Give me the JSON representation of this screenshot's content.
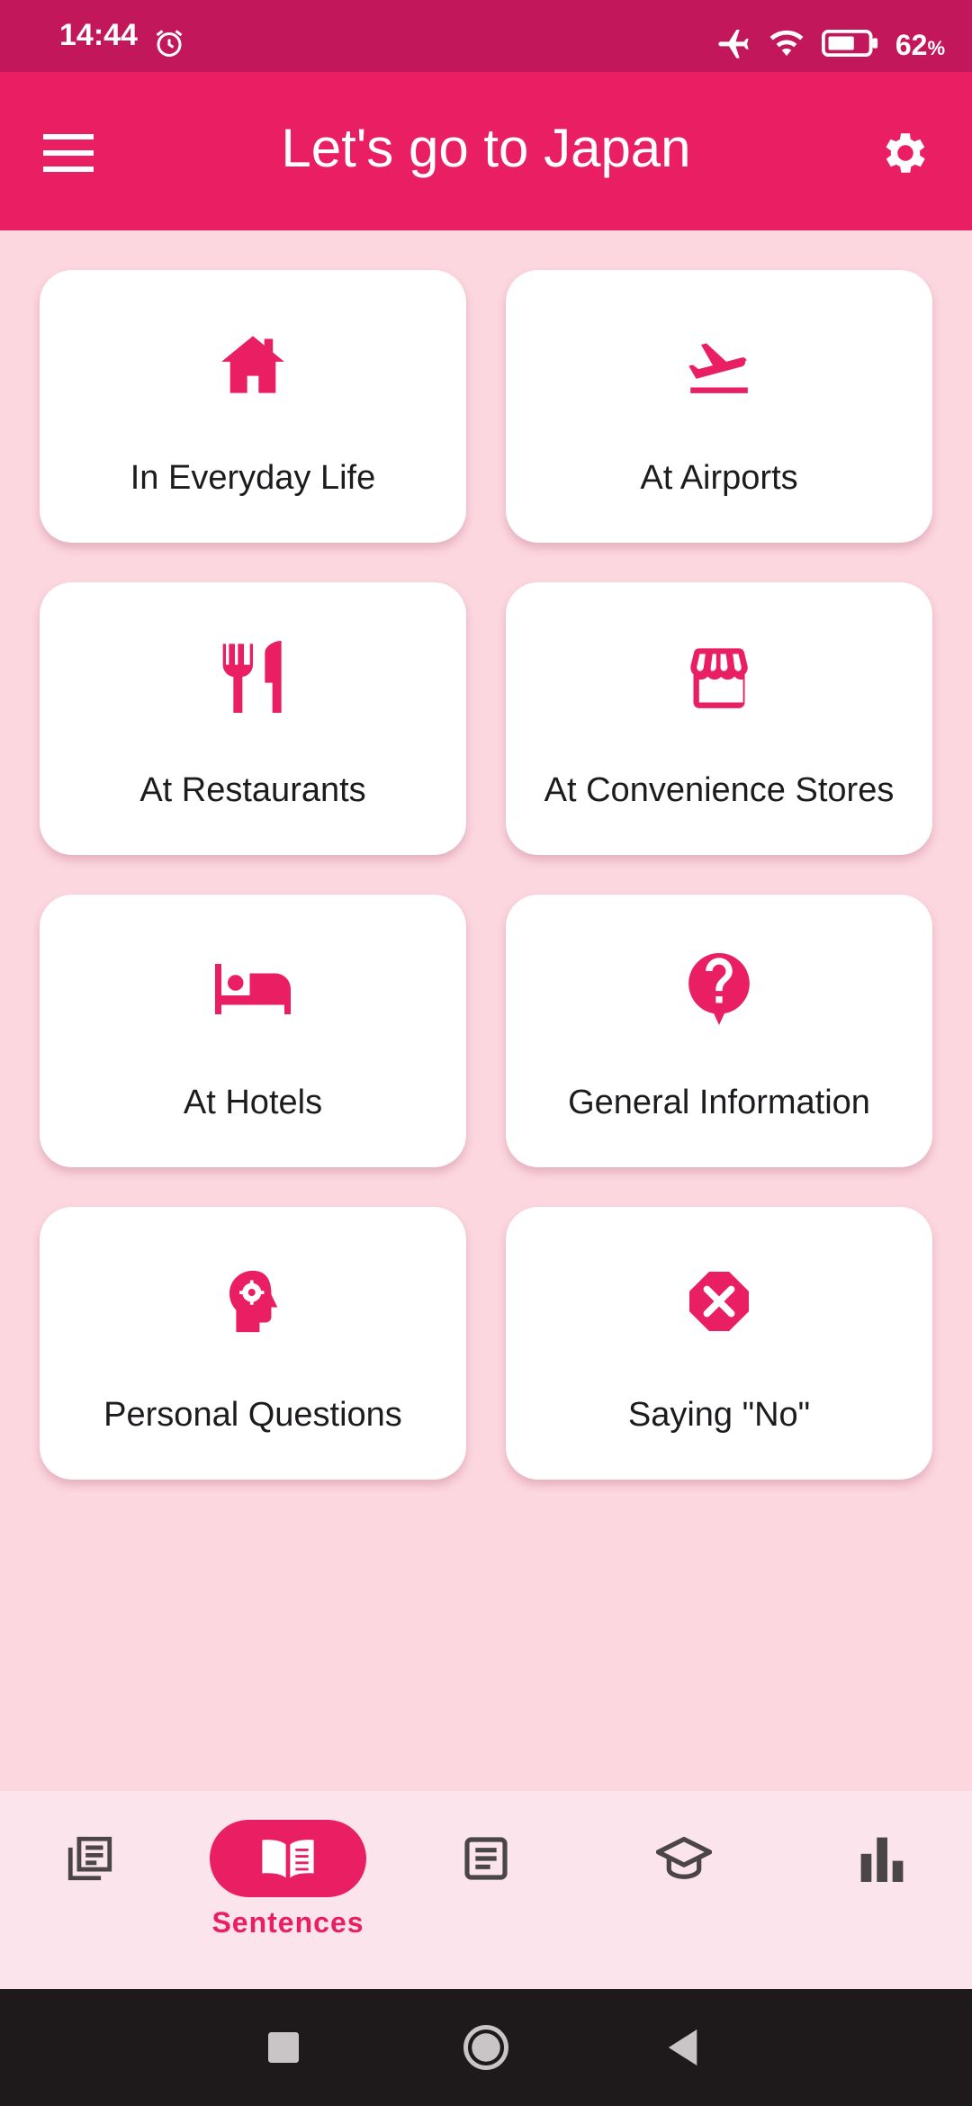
{
  "status": {
    "time": "14:44",
    "battery_percent": "62",
    "battery_unit": "%",
    "icons": [
      "alarm-icon",
      "airplane-mode-icon",
      "wifi-icon",
      "battery-icon"
    ]
  },
  "app_bar": {
    "title": "Let's go to Japan",
    "menu_icon": "menu-icon",
    "settings_icon": "gear-icon"
  },
  "categories": [
    {
      "label": "In Everyday Life",
      "icon": "home-icon"
    },
    {
      "label": "At Airports",
      "icon": "flight-takeoff-icon"
    },
    {
      "label": "At Restaurants",
      "icon": "restaurant-icon"
    },
    {
      "label": "At Convenience Stores",
      "icon": "store-icon"
    },
    {
      "label": "At Hotels",
      "icon": "hotel-bed-icon"
    },
    {
      "label": "General Information",
      "icon": "help-icon"
    },
    {
      "label": "Personal Questions",
      "icon": "psychology-icon"
    },
    {
      "label": "Saying \"No\"",
      "icon": "cancel-octagon-icon"
    }
  ],
  "bottom_nav": {
    "items": [
      {
        "icon": "library-icon",
        "label": ""
      },
      {
        "icon": "book-icon",
        "label": "Sentences",
        "active": true
      },
      {
        "icon": "article-icon",
        "label": ""
      },
      {
        "icon": "school-icon",
        "label": ""
      },
      {
        "icon": "bar-chart-icon",
        "label": ""
      }
    ]
  },
  "system_nav": {
    "icons": [
      "recents-icon",
      "home-circle-icon",
      "back-icon"
    ]
  },
  "colors": {
    "primary": "#e91e63",
    "status_bar": "#c2185b",
    "background": "#fcd7e0",
    "nav_background": "#fce4ec",
    "icon_inactive": "#4a4547"
  }
}
